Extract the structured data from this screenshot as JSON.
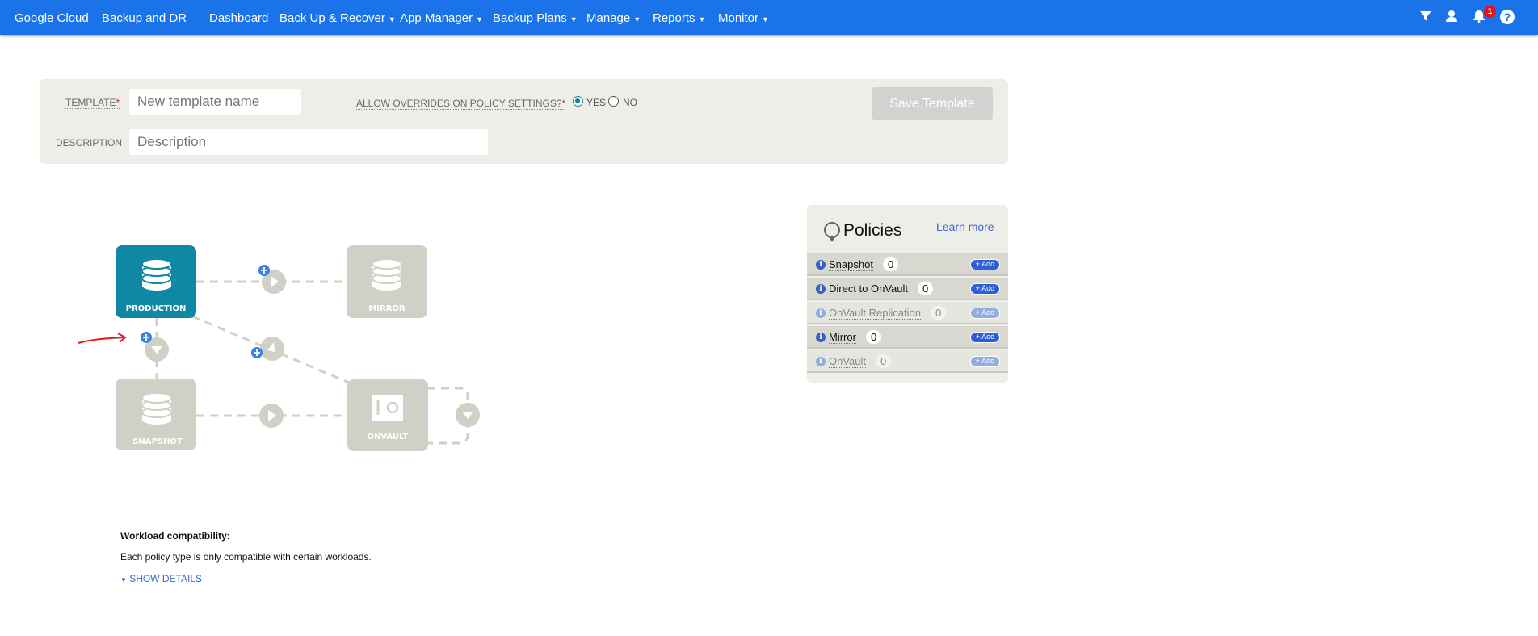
{
  "nav": {
    "brand": "Google Cloud",
    "product": "Backup and DR",
    "items": [
      {
        "label": "Dashboard",
        "dropdown": false
      },
      {
        "label": "Back Up & Recover",
        "dropdown": true
      },
      {
        "label": "App Manager",
        "dropdown": true
      },
      {
        "label": "Backup Plans",
        "dropdown": true
      },
      {
        "label": "Manage",
        "dropdown": true
      },
      {
        "label": "Reports",
        "dropdown": true
      },
      {
        "label": "Monitor",
        "dropdown": true
      }
    ],
    "icons": [
      "filter-icon",
      "user-icon",
      "bell-icon",
      "help-icon"
    ],
    "notification_count": "1"
  },
  "form": {
    "template_label": "TEMPLATE",
    "required_mark": "*",
    "template_placeholder": "New template name",
    "overrides_label": "ALLOW OVERRIDES ON POLICY SETTINGS?",
    "yes": "YES",
    "no": "NO",
    "selected": "YES",
    "description_label": "DESCRIPTION",
    "description_placeholder": "Description",
    "save": "Save Template"
  },
  "diagram": {
    "nodes": {
      "production": "PRODUCTION",
      "mirror": "MIRROR",
      "snapshot": "SNAPSHOT",
      "onvault": "ONVAULT"
    }
  },
  "policies": {
    "title": "Policies",
    "learn_more": "Learn more",
    "rows": [
      {
        "name": "Snapshot",
        "count": "0",
        "add": "+ Add",
        "enabled": true
      },
      {
        "name": "Direct to OnVault",
        "count": "0",
        "add": "+ Add",
        "enabled": true
      },
      {
        "name": "OnVault Replication",
        "count": "0",
        "add": "+ Add",
        "enabled": false
      },
      {
        "name": "Mirror",
        "count": "0",
        "add": "+ Add",
        "enabled": true
      },
      {
        "name": "OnVault",
        "count": "0",
        "add": "+ Add",
        "enabled": false
      }
    ]
  },
  "workload": {
    "title": "Workload compatibility:",
    "body": "Each policy type is only compatible with certain workloads.",
    "show_details": "SHOW DETAILS"
  },
  "colors": {
    "nav": "#1a73e8",
    "production": "#1187a6",
    "inactive_node": "#d0d0c6",
    "add_blue": "#3b82e8"
  }
}
